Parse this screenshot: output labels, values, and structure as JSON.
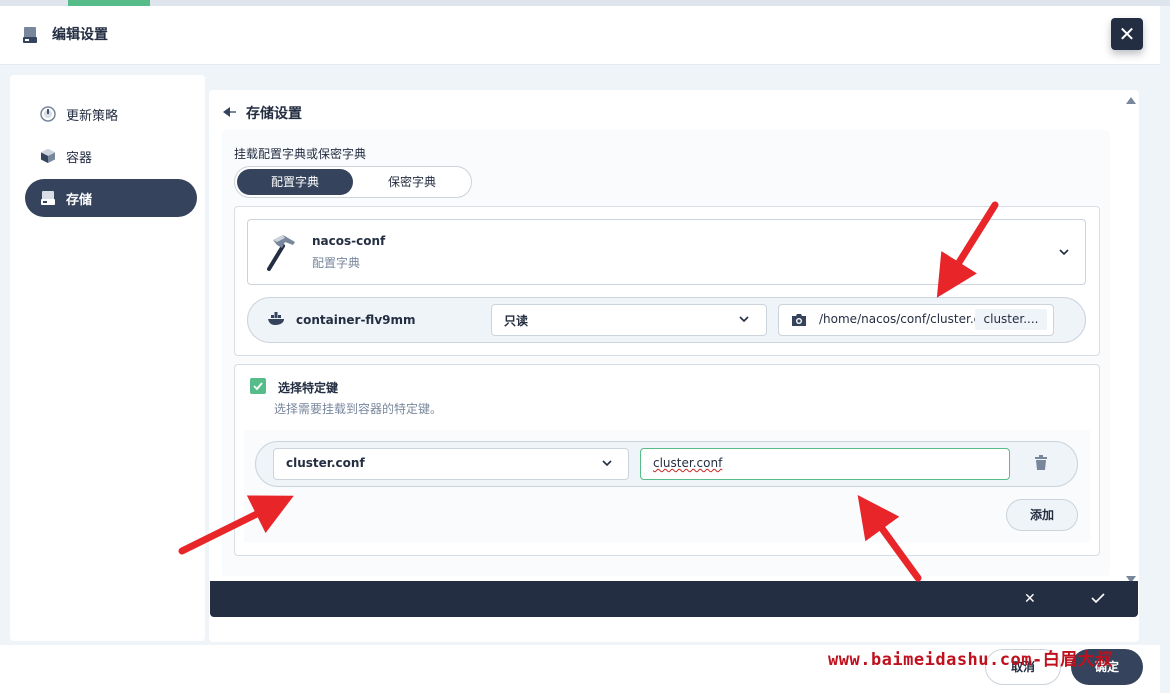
{
  "dialog": {
    "title": "编辑设置",
    "close_symbol": "✕"
  },
  "sidebar": {
    "items": [
      {
        "label": "更新策略",
        "icon": "update-strategy-icon"
      },
      {
        "label": "容器",
        "icon": "container-icon"
      },
      {
        "label": "存储",
        "icon": "storage-icon",
        "active": true
      }
    ]
  },
  "storage": {
    "section_title": "存储设置",
    "mount_label": "挂载配置字典或保密字典",
    "tabs": [
      {
        "label": "配置字典",
        "active": true
      },
      {
        "label": "保密字典",
        "active": false
      }
    ],
    "configmap": {
      "name": "nacos-conf",
      "type": "配置字典"
    },
    "mount": {
      "container": "container-flv9mm",
      "mode": "只读",
      "path": "/home/nacos/conf/cluster.conf",
      "sub_path_tag": "cluster...."
    },
    "specific_keys": {
      "checked": true,
      "title": "选择特定键",
      "description": "选择需要挂载到容器的特定键。",
      "rows": [
        {
          "key": "cluster.conf",
          "path": "cluster.conf"
        }
      ],
      "add_label": "添加"
    }
  },
  "bottom_bar": {
    "cancel_symbol": "✕"
  },
  "footer": {
    "cancel_label": "取消",
    "ok_label": "确定"
  },
  "watermark": "www.baimeidashu.com-白眉大叔",
  "colors": {
    "primary_dark": "#36435c",
    "header_dark": "#242e42",
    "success_green": "#55bc8a",
    "annotation_red": "#e8262a"
  }
}
